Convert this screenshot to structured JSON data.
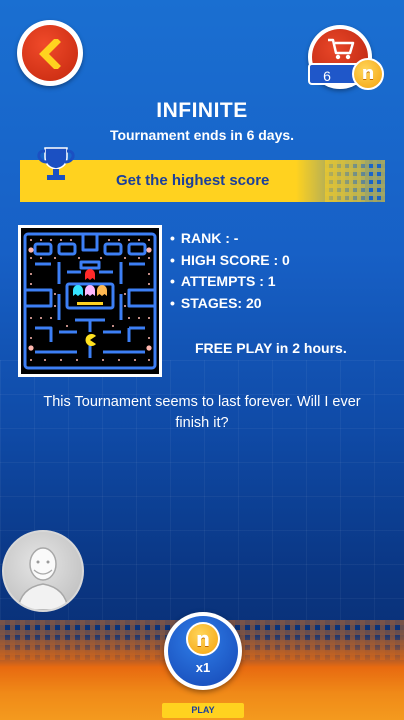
{
  "header": {
    "title": "INFINITE",
    "subtitle": "Tournament ends in 6 days."
  },
  "shop": {
    "coin_count": "6",
    "coin_symbol": "n",
    "cart_icon": "shopping-cart-icon"
  },
  "goal": {
    "text": "Get the highest score",
    "icon": "trophy-icon"
  },
  "stats": {
    "rank": "RANK : -",
    "high_score": "HIGH SCORE : 0",
    "attempts": "ATTEMPTS : 1",
    "stages": "STAGES: 20"
  },
  "free_play": "FREE PLAY in 2 hours.",
  "description": "This Tournament seems to last forever. Will I ever finish it?",
  "play": {
    "cost": "x1",
    "coin_symbol": "n",
    "label": "PLAY"
  },
  "colors": {
    "background": "#1760c6",
    "banner": "#ffd21f",
    "button_red": "#d93418",
    "coin": "#f4a20d"
  }
}
